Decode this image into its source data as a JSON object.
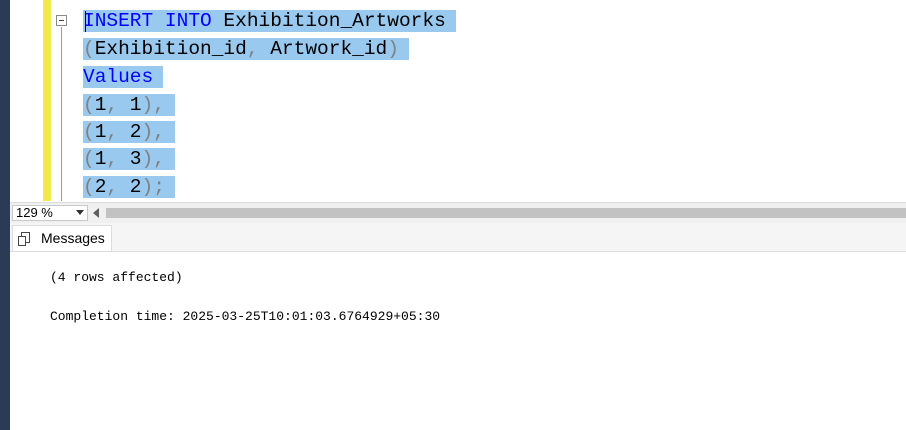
{
  "editor": {
    "lines": [
      {
        "parts": [
          {
            "text": "INSERT",
            "cls": "kw"
          },
          {
            "text": " ",
            "cls": ""
          },
          {
            "text": "INTO",
            "cls": "kw"
          },
          {
            "text": " Exhibition_Artworks",
            "cls": ""
          }
        ]
      },
      {
        "parts": [
          {
            "text": "(",
            "cls": "gr"
          },
          {
            "text": "Exhibition_id",
            "cls": ""
          },
          {
            "text": ",",
            "cls": "gr"
          },
          {
            "text": " Artwork_id",
            "cls": ""
          },
          {
            "text": ")",
            "cls": "gr"
          }
        ]
      },
      {
        "parts": [
          {
            "text": "Values",
            "cls": "kw"
          }
        ]
      },
      {
        "parts": [
          {
            "text": "(",
            "cls": "gr"
          },
          {
            "text": "1",
            "cls": ""
          },
          {
            "text": ",",
            "cls": "gr"
          },
          {
            "text": " 1",
            "cls": ""
          },
          {
            "text": "),",
            "cls": "gr"
          }
        ]
      },
      {
        "parts": [
          {
            "text": "(",
            "cls": "gr"
          },
          {
            "text": "1",
            "cls": ""
          },
          {
            "text": ",",
            "cls": "gr"
          },
          {
            "text": " 2",
            "cls": ""
          },
          {
            "text": "),",
            "cls": "gr"
          }
        ]
      },
      {
        "parts": [
          {
            "text": "(",
            "cls": "gr"
          },
          {
            "text": "1",
            "cls": ""
          },
          {
            "text": ",",
            "cls": "gr"
          },
          {
            "text": " 3",
            "cls": ""
          },
          {
            "text": "),",
            "cls": "gr"
          }
        ]
      },
      {
        "parts": [
          {
            "text": "(",
            "cls": "gr"
          },
          {
            "text": "2",
            "cls": ""
          },
          {
            "text": ",",
            "cls": "gr"
          },
          {
            "text": " 2",
            "cls": ""
          },
          {
            "text": ");",
            "cls": "gr"
          }
        ]
      }
    ]
  },
  "statusbar": {
    "zoom": "129 %"
  },
  "results": {
    "tab_label": "Messages",
    "rows_affected": "(4 rows affected)",
    "completion_time": "Completion time: 2025-03-25T10:01:03.6764929+05:30"
  },
  "colors": {
    "keyword": "#0000ff",
    "punctuation": "#808080",
    "selection": "#99c9ef",
    "change_bar": "#f3e84a"
  },
  "icons": {
    "collapse": "collapse-minus-icon",
    "messages": "messages-icon",
    "dropdown": "chevron-down-icon",
    "scroll_left": "scroll-left-arrow-icon"
  }
}
